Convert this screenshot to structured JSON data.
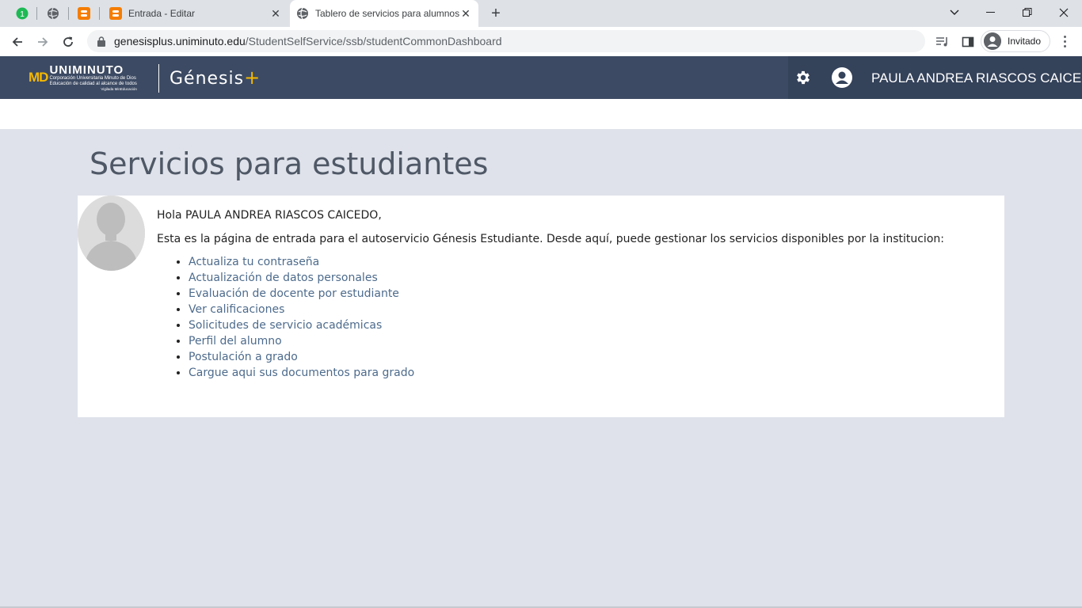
{
  "browser": {
    "tabs": [
      {
        "title": "Entrada - Editar"
      },
      {
        "title": "Tablero de servicios para alumnos"
      }
    ],
    "pinned_badge": "1",
    "url_host": "genesisplus.uniminuto.edu",
    "url_path": "/StudentSelfService/ssb/studentCommonDashboard",
    "profile_label": "Invitado"
  },
  "header": {
    "logo_md": "MD",
    "logo_name": "UNIMINUTO",
    "logo_line1": "Corporación Universitaria Minuto de Dios",
    "logo_line2": "Educación de calidad al alcance de todos",
    "logo_line3": "Vigilada MinEducación",
    "product_name": "Génesis",
    "product_plus": "+",
    "user_name": "PAULA ANDREA RIASCOS CAICEDO"
  },
  "main": {
    "title": "Servicios para estudiantes",
    "greeting": "Hola PAULA ANDREA RIASCOS CAICEDO,",
    "intro": "Esta es la página de entrada para el autoservicio Génesis Estudiante. Desde aquí, puede gestionar los servicios disponibles por la institucion:",
    "links": [
      "Actualiza tu contraseña",
      "Actualización de datos personales",
      "Evaluación de docente por estudiante",
      "Ver calificaciones",
      "Solicitudes de servicio académicas",
      "Perfil del alumno",
      "Postulación a grado",
      "Cargue aqui sus documentos para grado"
    ]
  },
  "colors": {
    "header_bg": "#3c4a63",
    "accent_yellow": "#f5b800",
    "link": "#4d6b8c",
    "page_bg": "#dfe2ea"
  }
}
